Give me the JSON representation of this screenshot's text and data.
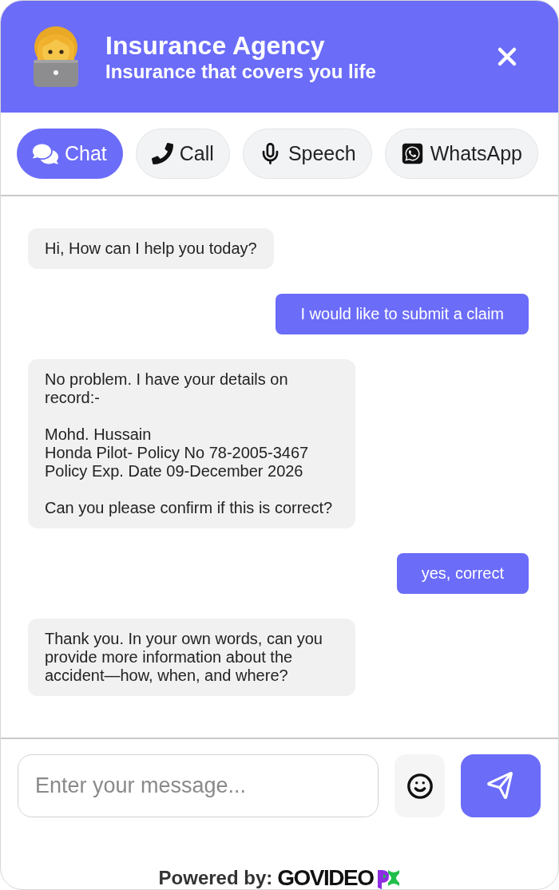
{
  "header": {
    "title": "Insurance Agency",
    "subtitle": "Insurance that covers you life"
  },
  "tabs": [
    {
      "kind": "chat",
      "label": "Chat",
      "selected": true
    },
    {
      "kind": "call",
      "label": "Call",
      "selected": false
    },
    {
      "kind": "speech",
      "label": "Speech",
      "selected": false
    },
    {
      "kind": "whatsapp",
      "label": "WhatsApp",
      "selected": false
    }
  ],
  "messages": [
    {
      "kind": "agent",
      "text": "Hi, How can I help you today?"
    },
    {
      "kind": "user",
      "text": "I would like to submit a claim"
    },
    {
      "kind": "agent",
      "text": "No problem. I have your details on record:-\n\nMohd. Hussain\nHonda Pilot- Policy No 78-2005-3467\nPolicy Exp. Date 09-December 2026\n\nCan you please confirm if this is correct?"
    },
    {
      "kind": "user",
      "text": "yes, correct"
    },
    {
      "kind": "agent",
      "text": "Thank you. In your own words, can you provide more information about the accident—how, when, and where?"
    }
  ],
  "composer": {
    "placeholder": "Enter your message..."
  },
  "footer": {
    "label": "Powered by:",
    "brand": "GOVIDEO"
  }
}
